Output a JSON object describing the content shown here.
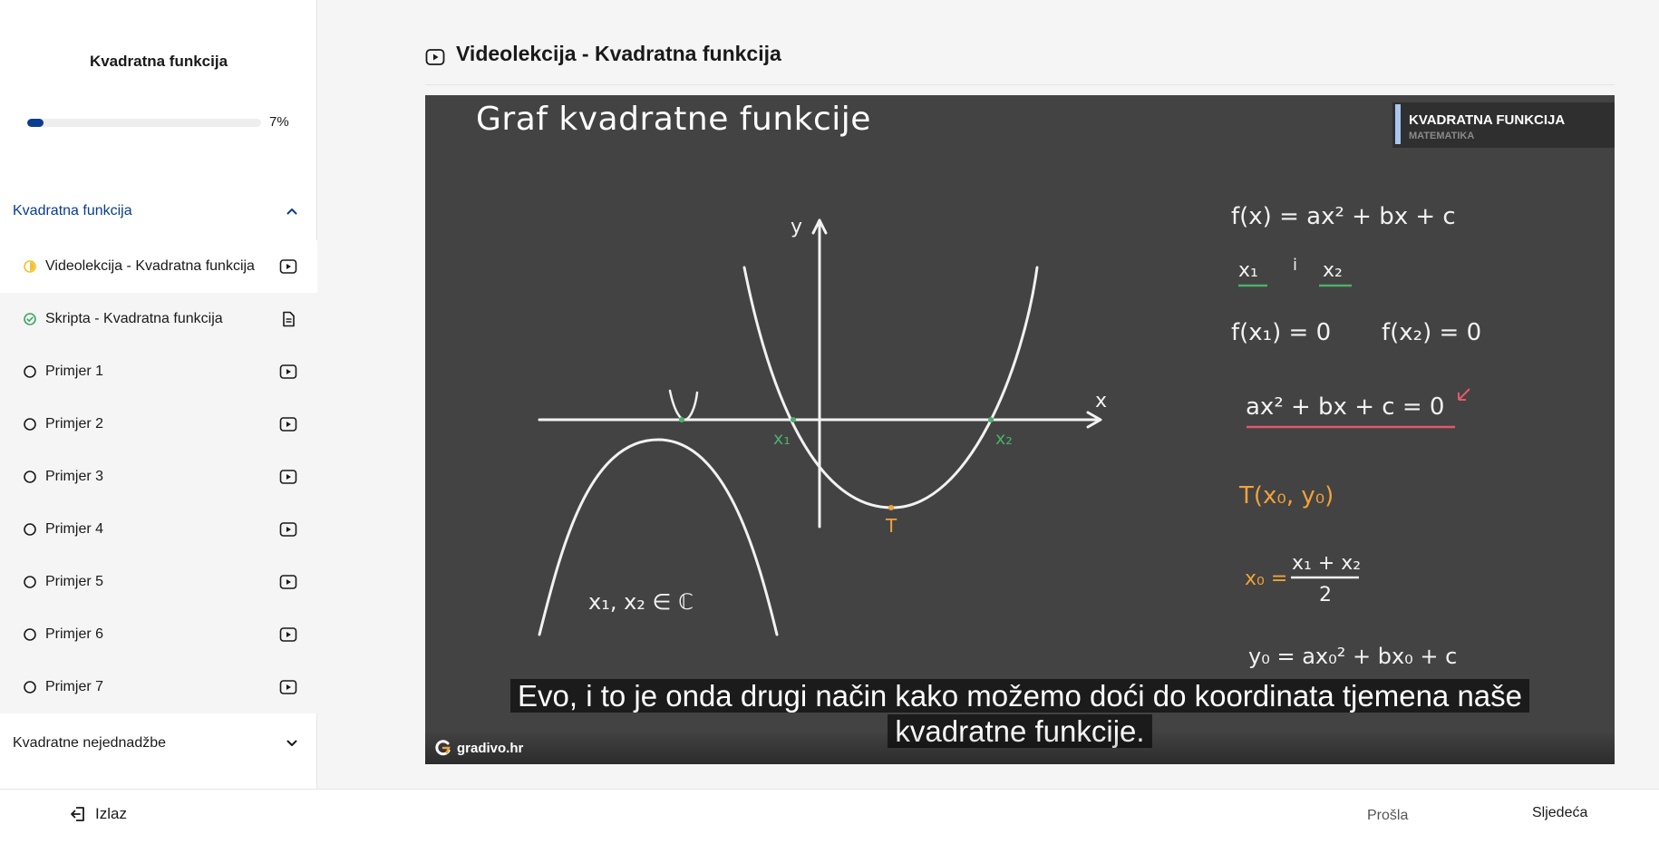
{
  "sidebar": {
    "course_title": "Kvadratna funkcija",
    "progress": {
      "percent_value": 7,
      "label": "7%"
    },
    "chapters": [
      {
        "label": "Kvadratna funkcija",
        "expanded": true
      },
      {
        "label": "Kvadratne nejednadžbe",
        "expanded": false
      }
    ],
    "lessons": [
      {
        "label": "Videolekcija - Kvadratna funkcija",
        "status": "in-progress",
        "type": "video-icon"
      },
      {
        "label": "Skripta - Kvadratna funkcija",
        "status": "completed",
        "type": "document-icon"
      },
      {
        "label": "Primjer 1",
        "status": "not-started",
        "type": "video-icon"
      },
      {
        "label": "Primjer 2",
        "status": "not-started",
        "type": "video-icon"
      },
      {
        "label": "Primjer 3",
        "status": "not-started",
        "type": "video-icon"
      },
      {
        "label": "Primjer 4",
        "status": "not-started",
        "type": "video-icon"
      },
      {
        "label": "Primjer 5",
        "status": "not-started",
        "type": "video-icon"
      },
      {
        "label": "Primjer 6",
        "status": "not-started",
        "type": "video-icon"
      },
      {
        "label": "Primjer 7",
        "status": "not-started",
        "type": "video-icon"
      }
    ]
  },
  "main": {
    "title": "Videolekcija - Kvadratna funkcija",
    "video": {
      "board_title": "Graf kvadratne funkcije",
      "badge_title": "KVADRATNA FUNKCIJA",
      "badge_subtitle": "MATEMATIKA",
      "subtitle_line1": "Evo, i to je onda drugi način kako možemo doći do koordinata tjemena naše",
      "subtitle_line2": "kvadratne funkcije.",
      "brand": "gradivo.hr",
      "board": {
        "axis_x": "x",
        "axis_y": "y",
        "root1": "x₁",
        "root2": "x₂",
        "vertex": "T",
        "complex_roots": "x₁, x₂ ∈ ℂ",
        "f1": "f(x) = ax² + bx + c",
        "f2a": "x₁",
        "f2b": "i",
        "f2c": "x₂",
        "f3a": "f(x₁) = 0",
        "f3b": "f(x₂) = 0",
        "f4": "ax² + bx + c = 0",
        "f5": "T(x₀, y₀)",
        "f6_left": "x₀ =",
        "f6_num": "x₁ + x₂",
        "f6_den": "2",
        "f7": "y₀ = ax₀² + bx₀ + c"
      }
    }
  },
  "footer": {
    "exit_label": "Izlaz",
    "prev_label": "Prošla",
    "next_label": "Sljedeća"
  },
  "colors": {
    "accent": "#0a3d8f",
    "board": "#434343",
    "chalk_green": "#4caf6a",
    "chalk_orange": "#f0a23a",
    "chalk_red": "#e05a6a",
    "in_progress": "#f2c230",
    "completed": "#3aa860"
  }
}
